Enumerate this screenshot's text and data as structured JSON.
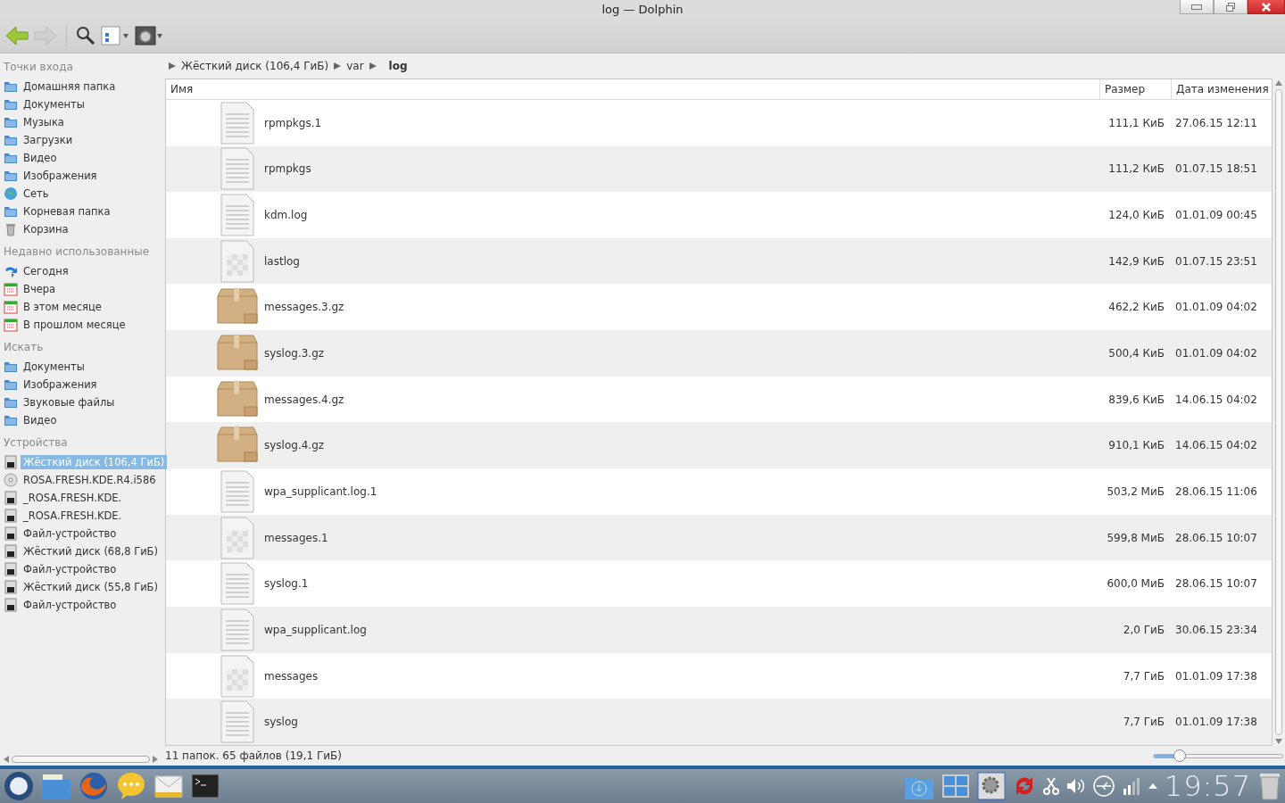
{
  "window": {
    "title": "log — Dolphin"
  },
  "sidebar": {
    "sections": [
      {
        "title": "Точки входа",
        "items": [
          {
            "label": "Домашняя папка",
            "kind": "folder",
            "selected": false
          },
          {
            "label": "Документы",
            "kind": "folder",
            "selected": false
          },
          {
            "label": "Музыка",
            "kind": "folder",
            "selected": false
          },
          {
            "label": "Загрузки",
            "kind": "folder",
            "selected": false
          },
          {
            "label": "Видео",
            "kind": "folder",
            "selected": false
          },
          {
            "label": "Изображения",
            "kind": "folder",
            "selected": false
          },
          {
            "label": "Сеть",
            "kind": "network",
            "selected": false
          },
          {
            "label": "Корневая папка",
            "kind": "folder",
            "selected": false
          },
          {
            "label": "Корзина",
            "kind": "trash",
            "selected": false
          }
        ]
      },
      {
        "title": "Недавно использованные",
        "items": [
          {
            "label": "Сегодня",
            "kind": "recent",
            "selected": false
          },
          {
            "label": "Вчера",
            "kind": "calendar",
            "selected": false
          },
          {
            "label": "В этом месяце",
            "kind": "calendar",
            "selected": false
          },
          {
            "label": "В прошлом месяце",
            "kind": "calendar",
            "selected": false
          }
        ]
      },
      {
        "title": "Искать",
        "items": [
          {
            "label": "Документы",
            "kind": "folder",
            "selected": false
          },
          {
            "label": "Изображения",
            "kind": "folder",
            "selected": false
          },
          {
            "label": "Звуковые файлы",
            "kind": "folder",
            "selected": false
          },
          {
            "label": "Видео",
            "kind": "folder",
            "selected": false
          }
        ]
      },
      {
        "title": "Устройства",
        "items": [
          {
            "label": "Жёсткий диск (106,4 ГиБ)",
            "kind": "drive",
            "selected": true
          },
          {
            "label": "ROSA.FRESH.KDE.R4.i586",
            "kind": "disc",
            "selected": false
          },
          {
            "label": "_ROSA.FRESH.KDE.",
            "kind": "drive",
            "selected": false
          },
          {
            "label": "_ROSA.FRESH.KDE.",
            "kind": "drive",
            "selected": false
          },
          {
            "label": "Файл-устройство",
            "kind": "drive",
            "selected": false
          },
          {
            "label": "Жёсткий диск (68,8 ГиБ)",
            "kind": "drive",
            "selected": false
          },
          {
            "label": "Файл-устройство",
            "kind": "drive",
            "selected": false
          },
          {
            "label": "Жёсткий диск (55,8 ГиБ)",
            "kind": "drive",
            "selected": false
          },
          {
            "label": "Файл-устройство",
            "kind": "drive",
            "selected": false
          }
        ]
      }
    ]
  },
  "breadcrumb": [
    "Жёсткий диск (106,4 ГиБ)",
    "var",
    "log"
  ],
  "table": {
    "columns": [
      "Имя",
      "Размер",
      "Дата изменения"
    ],
    "rows": [
      {
        "kind": "text",
        "name": "rpmpkgs.1",
        "size": "111,1 КиБ",
        "date": "27.06.15 12:11"
      },
      {
        "kind": "text",
        "name": "rpmpkgs",
        "size": "111,2 КиБ",
        "date": "01.07.15 18:51"
      },
      {
        "kind": "text",
        "name": "kdm.log",
        "size": "124,0 КиБ",
        "date": "01.01.09 00:45"
      },
      {
        "kind": "binary",
        "name": "lastlog",
        "size": "142,9 КиБ",
        "date": "01.07.15 23:51"
      },
      {
        "kind": "archive",
        "name": "messages.3.gz",
        "size": "462,2 КиБ",
        "date": "01.01.09 04:02"
      },
      {
        "kind": "archive",
        "name": "syslog.3.gz",
        "size": "500,4 КиБ",
        "date": "01.01.09 04:02"
      },
      {
        "kind": "archive",
        "name": "messages.4.gz",
        "size": "839,6 КиБ",
        "date": "14.06.15 04:02"
      },
      {
        "kind": "archive",
        "name": "syslog.4.gz",
        "size": "910,1 КиБ",
        "date": "14.06.15 04:02"
      },
      {
        "kind": "text",
        "name": "wpa_supplicant.log.1",
        "size": "503,2 МиБ",
        "date": "28.06.15 11:06"
      },
      {
        "kind": "binary",
        "name": "messages.1",
        "size": "599,8 МиБ",
        "date": "28.06.15 10:07"
      },
      {
        "kind": "text",
        "name": "syslog.1",
        "size": "600,0 МиБ",
        "date": "28.06.15 10:07"
      },
      {
        "kind": "text",
        "name": "wpa_supplicant.log",
        "size": "2,0 ГиБ",
        "date": "30.06.15 23:34"
      },
      {
        "kind": "binary",
        "name": "messages",
        "size": "7,7 ГиБ",
        "date": "01.01.09 17:38"
      },
      {
        "kind": "text",
        "name": "syslog",
        "size": "7,7 ГиБ",
        "date": "01.01.09 17:38"
      }
    ]
  },
  "status_bar": {
    "text": "11 папок. 65 файлов (19,1 ГиБ)",
    "zoom": {
      "level": 0.2
    }
  },
  "taskbar": {
    "clock": "19:57"
  }
}
